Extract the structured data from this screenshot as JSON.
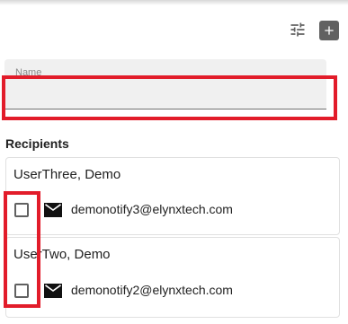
{
  "toolbar": {
    "filter_icon": "tune-icon",
    "add_icon": "add-icon"
  },
  "name_field": {
    "label": "Name",
    "value": ""
  },
  "recipients": {
    "title": "Recipients",
    "items": [
      {
        "name": "UserThree, Demo",
        "email": "demonotify3@elynxtech.com",
        "checked": false,
        "icon": "mail-icon"
      },
      {
        "name": "UserTwo, Demo",
        "email": "demonotify2@elynxtech.com",
        "checked": false,
        "icon": "mail-icon"
      }
    ]
  },
  "colors": {
    "highlight": "#e21c2a",
    "field_background": "#f0f0f0",
    "icon": "#616161"
  }
}
